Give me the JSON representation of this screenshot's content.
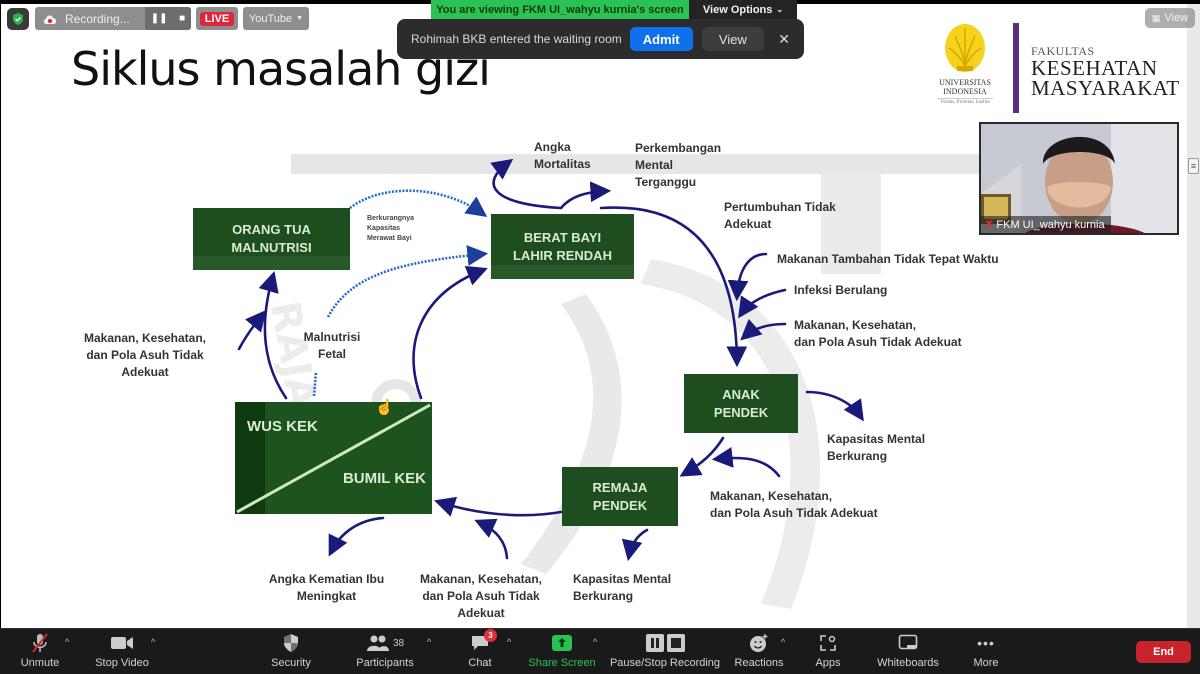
{
  "meeting": {
    "viewing_banner": "You are viewing FKM UI_wahyu kurnia's screen",
    "view_options_label": "View Options",
    "recording_status": "Recording...",
    "live_label": "LIVE",
    "stream_target": "YouTube",
    "gallery_view_label": "View"
  },
  "notification": {
    "message": "Rohimah BKB entered the waiting room",
    "admit_label": "Admit",
    "view_label": "View",
    "close_symbol": "✕"
  },
  "self_video": {
    "name": "FKM UI_wahyu kurnia",
    "muted": true
  },
  "slide": {
    "title": "Siklus masalah gizi",
    "logo": {
      "university_line1": "UNIVERSITAS",
      "university_line2": "INDONESIA",
      "motto": "Veritas, Probitas, Iustitia",
      "faculty_prefix": "FAKULTAS",
      "faculty_line1": "KESEHATAN",
      "faculty_line2": "MASYARAKAT"
    },
    "boxes": {
      "orang_tua": [
        "ORANG TUA",
        "MALNUTRISI"
      ],
      "bblr": [
        "BERAT BAYI",
        "LAHIR RENDAH"
      ],
      "anak": [
        "ANAK",
        "PENDEK"
      ],
      "remaja": [
        "REMAJA",
        "PENDEK"
      ],
      "wus": "WUS KEK",
      "bumil": "BUMIL KEK"
    },
    "labels": {
      "angka_mortalitas": [
        "Angka",
        "Mortalitas"
      ],
      "perkembangan_mental": [
        "Perkembangan",
        "Mental",
        "Terganggu"
      ],
      "pertumbuhan": [
        "Pertumbuhan Tidak",
        "Adekuat"
      ],
      "makanan_tambahan": "Makanan Tambahan Tidak Tepat Waktu",
      "infeksi": "Infeksi Berulang",
      "makanan_right": [
        "Makanan, Kesehatan,",
        "dan Pola Asuh Tidak Adekuat"
      ],
      "kapasitas_right": [
        "Kapasitas Mental",
        "Berkurang"
      ],
      "makanan_mid": [
        "Makanan, Kesehatan,",
        "dan Pola Asuh Tidak Adekuat"
      ],
      "kapasitas_bottom": [
        "Kapasitas Mental",
        "Berkurang"
      ],
      "makanan_bottom": [
        "Makanan, Kesehatan,",
        "dan Pola Asuh Tidak",
        "Adekuat"
      ],
      "angka_kematian": [
        "Angka Kematian Ibu",
        "Meningkat"
      ],
      "makanan_left": [
        "Makanan, Kesehatan,",
        "dan Pola Asuh Tidak",
        "Adekuat"
      ],
      "malnutrisi_fetal": [
        "Malnutrisi",
        "Fetal"
      ],
      "berkurangnya": [
        "Berkurangnya",
        "Kapasitas",
        "Merawat Bayi"
      ]
    }
  },
  "toolbar": {
    "unmute": "Unmute",
    "stop_video": "Stop Video",
    "security": "Security",
    "participants": "Participants",
    "participant_count": "38",
    "chat": "Chat",
    "chat_badge": "3",
    "share_screen": "Share Screen",
    "pause_stop_recording": "Pause/Stop Recording",
    "reactions": "Reactions",
    "apps": "Apps",
    "whiteboards": "Whiteboards",
    "more": "More",
    "end": "End"
  },
  "colors": {
    "share_green": "#2ac353",
    "admit_blue": "#0e71eb",
    "end_red": "#c9242c",
    "live_red": "#e0263c",
    "box_green": "#1e4d20",
    "arrow_navy": "#1a1a7a",
    "logo_purple": "#5c2e7e"
  }
}
